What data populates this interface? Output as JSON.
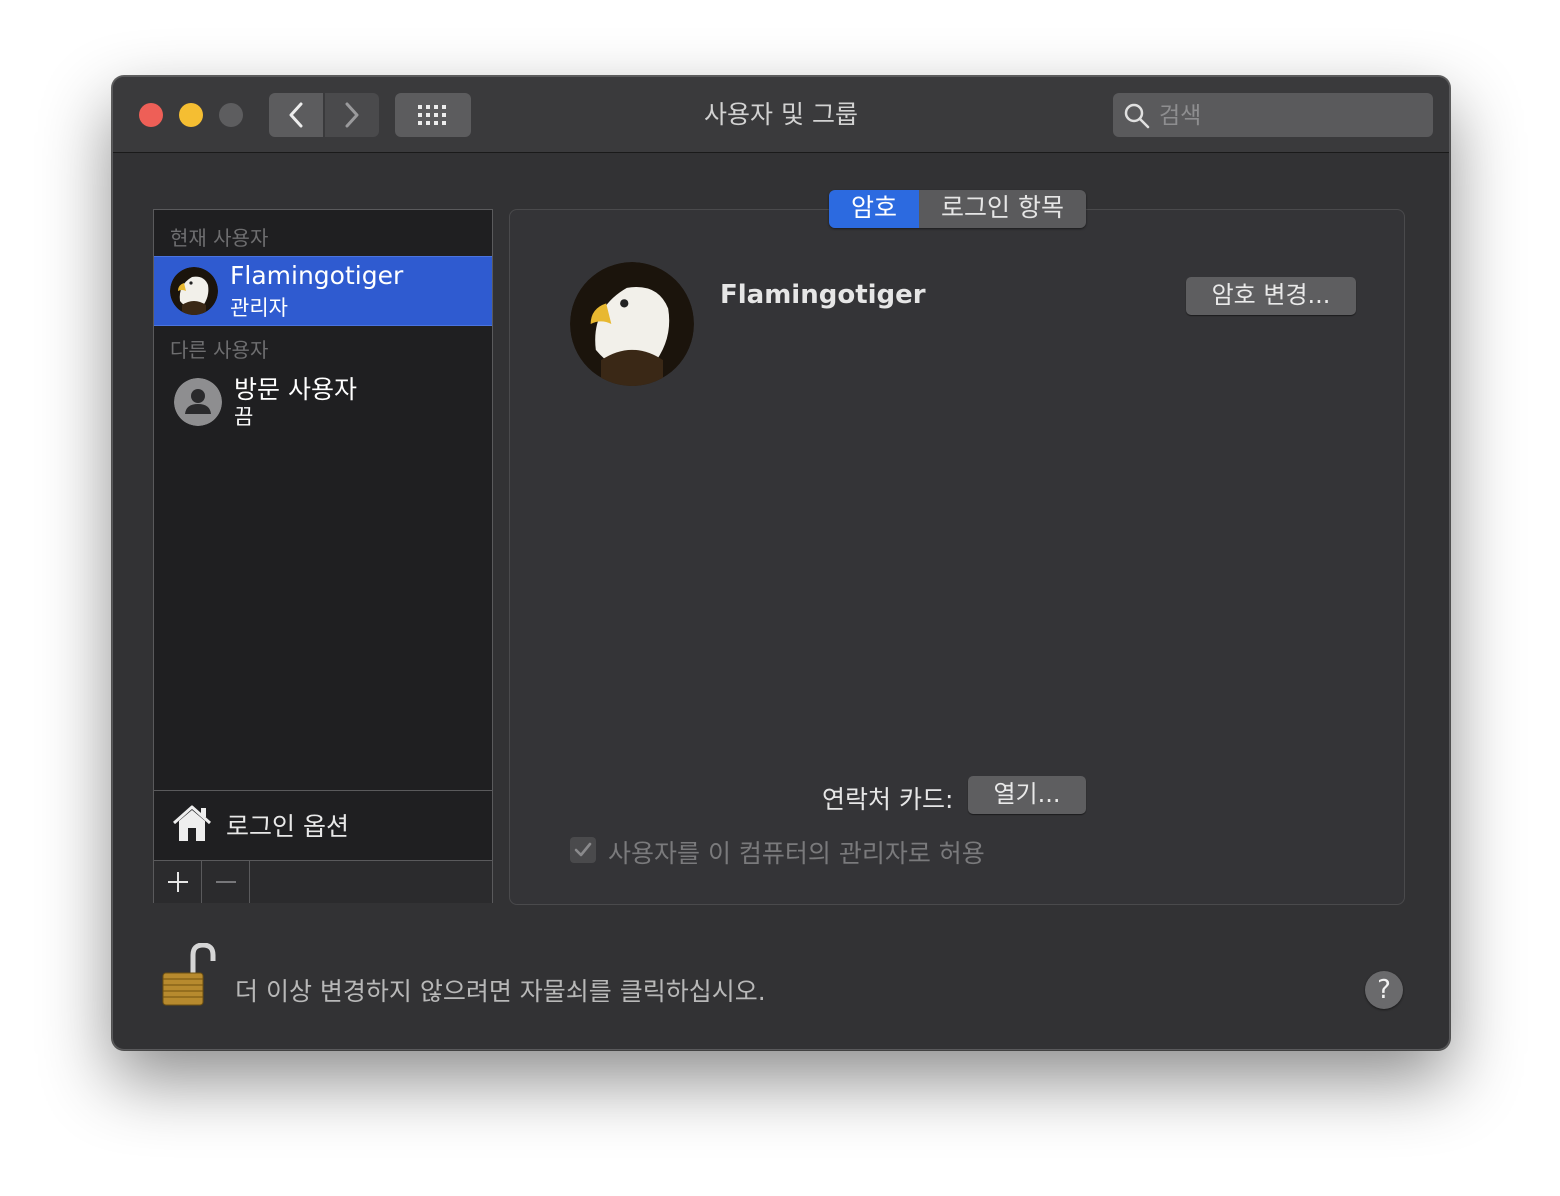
{
  "window": {
    "title": "사용자 및 그룹",
    "search": {
      "placeholder": "검색",
      "value": ""
    }
  },
  "sidebar": {
    "current_section": "현재 사용자",
    "current_user": {
      "name": "Flamingotiger",
      "role": "관리자"
    },
    "other_section": "다른 사용자",
    "other_users": [
      {
        "name": "방문 사용자",
        "status": "끔"
      }
    ],
    "login_options": "로그인 옵션",
    "add_button": "+",
    "remove_button": "—"
  },
  "detail": {
    "tabs": [
      {
        "label": "암호",
        "active": true
      },
      {
        "label": "로그인 항목",
        "active": false
      }
    ],
    "full_name": "Flamingotiger",
    "change_password_button": "암호 변경...",
    "contact_card_label": "연락처 카드:",
    "open_button": "열기...",
    "allow_admin_label": "사용자를 이 컴퓨터의 관리자로 허용",
    "allow_admin_checked": true
  },
  "footer": {
    "lock_message": "더 이상 변경하지 않으려면 자물쇠를 클릭하십시오.",
    "help_label": "?"
  },
  "icons": {
    "back": "chevron-left-icon",
    "forward": "chevron-right-icon",
    "grid": "grid-icon",
    "search": "search-icon",
    "home": "house-icon",
    "lock": "padlock-open-icon",
    "guest": "person-icon"
  },
  "colors": {
    "accent": "#2c6ae0",
    "selection": "#2f5bd0",
    "close": "#ee5f57",
    "minimize": "#f5be32"
  }
}
